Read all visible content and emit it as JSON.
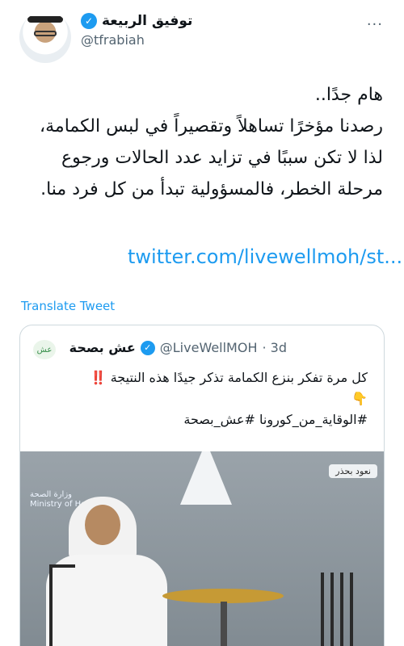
{
  "author": {
    "name": "توفيق الربيعة",
    "handle": "@tfrabiah"
  },
  "tweet": {
    "text": "هام جدًا..\nرصدنا مؤخرًا تساهلاً وتقصيراً في لبس الكمامة، لذا لا تكن سببًا في تزايد عدد الحالات ورجوع مرحلة الخطر، فالمسؤولية تبدأ من كل فرد منا.",
    "link": "twitter.com/livewellmoh/st..."
  },
  "translate_label": "Translate Tweet",
  "quoted": {
    "name": "عش بصحة",
    "handle": "@LiveWellMOH",
    "time": "· 3d",
    "line1": "كل مرة تفكر بنزع الكمامة تذكر جيدًا هذه النتيجة",
    "line1_emoji": "‼️",
    "line2_emoji": "👇",
    "hashtags": "#الوقاية_من_كورونا #عش_بصحة",
    "media": {
      "logo_text": "وزارة الصحة\nMinistry of Health",
      "tag": "نعود بحذر"
    }
  },
  "colors": {
    "accent": "#1d9bf0",
    "text": "#0f1419",
    "muted": "#536471",
    "border": "#cfd9de"
  },
  "icons": {
    "verified": "verified-badge-icon",
    "more": "more-dots-icon"
  }
}
